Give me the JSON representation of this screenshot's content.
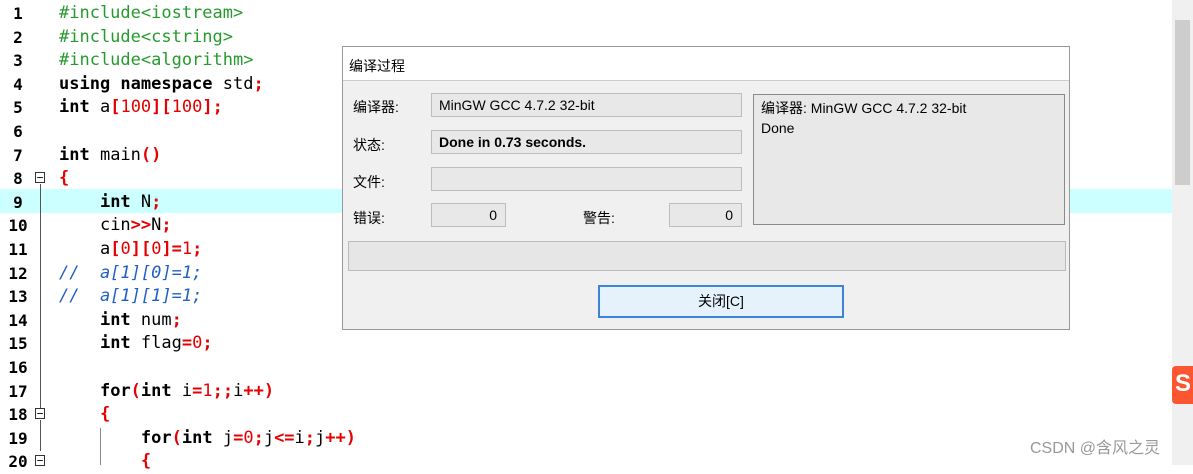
{
  "editor": {
    "lines": [
      {
        "n": "1"
      },
      {
        "n": "2"
      },
      {
        "n": "3"
      },
      {
        "n": "4"
      },
      {
        "n": "5"
      },
      {
        "n": "6"
      },
      {
        "n": "7"
      },
      {
        "n": "8"
      },
      {
        "n": "9"
      },
      {
        "n": "10"
      },
      {
        "n": "11"
      },
      {
        "n": "12"
      },
      {
        "n": "13"
      },
      {
        "n": "14"
      },
      {
        "n": "15"
      },
      {
        "n": "16"
      },
      {
        "n": "17"
      },
      {
        "n": "18"
      },
      {
        "n": "19"
      },
      {
        "n": "20"
      }
    ],
    "code": {
      "l1": "#include<iostream>",
      "l2": "#include<cstring>",
      "l3": "#include<algorithm>",
      "l4_kw": "using namespace",
      "l4_rest": " std",
      "l5_kw": "int",
      "l5_a": " a",
      "l5_n1": "100",
      "l5_n2": "100",
      "l7_kw": "int",
      "l7_rest": " main",
      "l9_kw": "int",
      "l9_rest": " N",
      "l10_a": "cin",
      "l10_b": "N",
      "l11_a": "a",
      "l11_n1": "0",
      "l11_n2": "0",
      "l11_n3": "1",
      "l12": "//  a[1][0]=1;",
      "l13": "//  a[1][1]=1;",
      "l14_kw": "int",
      "l14_rest": " num",
      "l15_kw": "int",
      "l15_rest": " flag",
      "l15_n": "0",
      "l17_kw1": "for",
      "l17_kw2": "int",
      "l17_i": " i",
      "l17_n": "1",
      "l17_rest": "i",
      "l19_kw1": "for",
      "l19_kw2": "int",
      "l19_j": " j",
      "l19_n": "0",
      "l19_rest1": "j",
      "l19_rest2": "i",
      "l19_rest3": "j"
    }
  },
  "dialog": {
    "title": "编译过程",
    "compiler_label": "编译器:",
    "compiler_value": "MinGW GCC 4.7.2 32-bit",
    "status_label": "状态:",
    "status_value": "Done in 0.73 seconds.",
    "file_label": "文件:",
    "file_value": "",
    "errors_label": "错误:",
    "errors_value": "0",
    "warnings_label": "警告:",
    "warnings_value": "0",
    "log_line1": "编译器: MinGW GCC 4.7.2 32-bit",
    "log_line2": "Done",
    "progress": 0,
    "close_label": "关闭[C]"
  },
  "watermark": "CSDN @含风之灵",
  "csdn_logo": "S"
}
